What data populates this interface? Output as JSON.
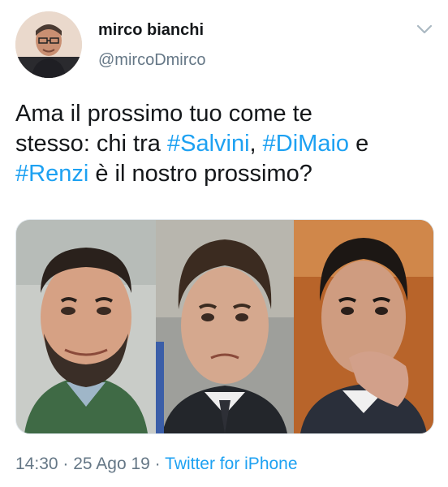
{
  "author": {
    "display_name": "mirco bianchi",
    "handle": "@mircoDmirco"
  },
  "tweet": {
    "line1": "Ama il prossimo tuo come te",
    "line2_text": "stesso: chi tra ",
    "hashtag_salvini": "#Salvini",
    "comma": ", ",
    "hashtag_dimaio": "#DiMaio",
    "line2_end": " e",
    "hashtag_renzi": "#Renzi",
    "line3_end": " è il nostro prossimo?"
  },
  "meta": {
    "time": "14:30",
    "separator1": " · ",
    "date": "25 Ago 19",
    "separator2": " · ",
    "source": "Twitter for iPhone"
  },
  "icons": {
    "caret": "chevron-down-icon"
  },
  "colors": {
    "link": "#1da1f2",
    "secondary_text": "#657786",
    "primary_text": "#14171a"
  }
}
